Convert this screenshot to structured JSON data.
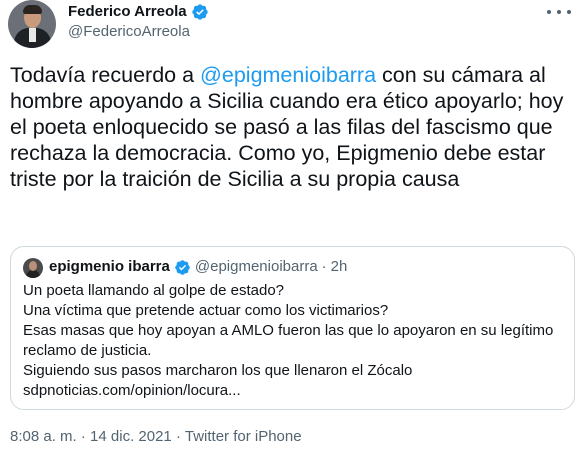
{
  "author": {
    "name": "Federico Arreola",
    "handle": "@FedericoArreola",
    "verified": true
  },
  "tweet": {
    "text_before": "Todavía recuerdo a ",
    "mention": "@epigmenioibarra",
    "text_after": " con su cámara al hombre apoyando a Sicilia cuando era ético apoyarlo; hoy el poeta enloquecido se pasó a las filas del fascismo que rechaza la democracia. Como yo, Epigmenio debe estar triste por la traición de Sicilia a su propia causa"
  },
  "quoted_tweet": {
    "name": "epigmenio ibarra",
    "handle": "@epigmenioibarra",
    "separator": "·",
    "time": "2h",
    "lines": [
      "Un poeta llamando al golpe de estado?",
      "Una víctima que pretende actuar como los victimarios?",
      "Esas masas que hoy apoyan a AMLO fueron las que lo apoyaron en su legítimo",
      "reclamo de justicia.",
      "Siguiendo sus pasos marcharon los que llenaron el Zócalo",
      "sdpnoticias.com/opinion/locura..."
    ]
  },
  "footer": {
    "time": "8:08 a. m.",
    "sep1": "·",
    "date": "14 dic. 2021",
    "sep2": "·",
    "source": "Twitter for iPhone"
  },
  "icons": {
    "verified": "verified-badge-icon",
    "more": "more-options-icon"
  },
  "colors": {
    "accent": "#1d9bf0",
    "text": "#0f1419",
    "muted": "#536471",
    "border": "#cfd9de"
  }
}
